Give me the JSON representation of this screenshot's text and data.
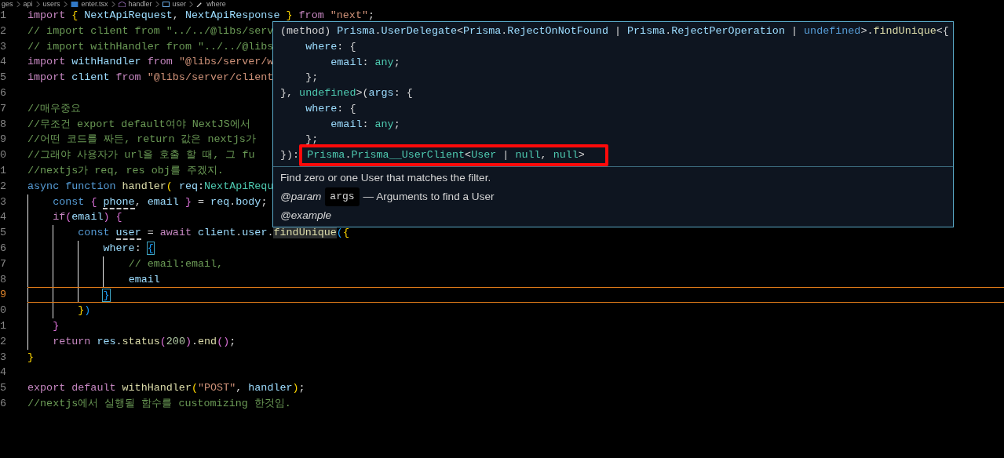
{
  "breadcrumb": [
    {
      "kind": "folder",
      "label": "ges"
    },
    {
      "kind": "folder",
      "label": "api"
    },
    {
      "kind": "folder",
      "label": "users"
    },
    {
      "kind": "file",
      "label": "enter.tsx"
    },
    {
      "kind": "function",
      "label": "handler"
    },
    {
      "kind": "variable",
      "label": "user"
    },
    {
      "kind": "property",
      "label": "where"
    }
  ],
  "editor": {
    "lines": [
      {
        "number": "1",
        "active": false,
        "tokens": [
          {
            "kind": "kw",
            "text": "import "
          },
          {
            "kind": "b1",
            "text": "{ "
          },
          {
            "kind": "var",
            "text": "NextApiRequest"
          },
          {
            "kind": "p",
            "text": ", "
          },
          {
            "kind": "var",
            "text": "NextApiResponse "
          },
          {
            "kind": "b1",
            "text": "} "
          },
          {
            "kind": "kw",
            "text": "from "
          },
          {
            "kind": "str",
            "text": "\"next\""
          },
          {
            "kind": "p",
            "text": ";"
          }
        ]
      },
      {
        "number": "2",
        "active": false,
        "tokens": [
          {
            "kind": "com",
            "text": "// import client from \"../../@libs/serv"
          }
        ]
      },
      {
        "number": "3",
        "active": false,
        "tokens": [
          {
            "kind": "com",
            "text": "// import withHandler from \"../../@libs"
          }
        ]
      },
      {
        "number": "4",
        "active": false,
        "tokens": [
          {
            "kind": "kw",
            "text": "import "
          },
          {
            "kind": "var",
            "text": "withHandler "
          },
          {
            "kind": "kw",
            "text": "from "
          },
          {
            "kind": "str",
            "text": "\"@libs/server/w"
          }
        ]
      },
      {
        "number": "5",
        "active": false,
        "tokens": [
          {
            "kind": "kw",
            "text": "import "
          },
          {
            "kind": "var",
            "text": "client "
          },
          {
            "kind": "kw",
            "text": "from "
          },
          {
            "kind": "str",
            "text": "\"@libs/server/client"
          }
        ]
      },
      {
        "number": "6",
        "active": false
      },
      {
        "number": "7",
        "active": false,
        "tokens": [
          {
            "kind": "com",
            "text": "//매우중요"
          }
        ]
      },
      {
        "number": "8",
        "active": false,
        "tokens": [
          {
            "kind": "com",
            "text": "//무조건 export default여야 NextJS에서"
          }
        ]
      },
      {
        "number": "9",
        "active": false,
        "tokens": [
          {
            "kind": "com",
            "text": "//어떤 코드를 짜든, return 값은 nextjs가"
          }
        ]
      },
      {
        "number": "0",
        "active": false,
        "tokens": [
          {
            "kind": "com",
            "text": "//그래야 사용자가 url을 호출 할 때, 그 fu"
          }
        ]
      },
      {
        "number": "1",
        "active": false,
        "tokens": [
          {
            "kind": "com",
            "text": "//nextjs가 req, res obj를 주겠지."
          }
        ]
      },
      {
        "number": "2",
        "active": false,
        "tokens": [
          {
            "kind": "st",
            "text": "async "
          },
          {
            "kind": "st",
            "text": "function "
          },
          {
            "kind": "fn",
            "text": "handler"
          },
          {
            "kind": "b1",
            "text": "( "
          },
          {
            "kind": "var",
            "text": "req"
          },
          {
            "kind": "p",
            "text": ":"
          },
          {
            "kind": "type",
            "text": "NextApiRequ"
          }
        ]
      },
      {
        "number": "3",
        "active": false,
        "tokens": [
          {
            "kind": "st",
            "text": "    const "
          },
          {
            "kind": "b2",
            "text": "{ "
          },
          {
            "kind": "unused",
            "text": "phone"
          },
          {
            "kind": "p",
            "text": ", "
          },
          {
            "kind": "var",
            "text": "email "
          },
          {
            "kind": "b2",
            "text": "}"
          },
          {
            "kind": "p",
            "text": " = "
          },
          {
            "kind": "var",
            "text": "req"
          },
          {
            "kind": "p",
            "text": "."
          },
          {
            "kind": "var",
            "text": "body"
          },
          {
            "kind": "p",
            "text": ";"
          }
        ]
      },
      {
        "number": "4",
        "active": false,
        "tokens": [
          {
            "kind": "kw",
            "text": "    if"
          },
          {
            "kind": "b2",
            "text": "("
          },
          {
            "kind": "var",
            "text": "email"
          },
          {
            "kind": "b2",
            "text": ") {"
          }
        ]
      },
      {
        "number": "5",
        "active": false,
        "tokens": [
          {
            "kind": "st",
            "text": "        const "
          },
          {
            "kind": "unused",
            "text": "user"
          },
          {
            "kind": "p",
            "text": " = "
          },
          {
            "kind": "kw",
            "text": "await "
          },
          {
            "kind": "var",
            "text": "client"
          },
          {
            "kind": "p",
            "text": "."
          },
          {
            "kind": "var",
            "text": "user"
          },
          {
            "kind": "p",
            "text": "."
          },
          {
            "kind": "fnhl",
            "text": "findUnique"
          },
          {
            "kind": "b3",
            "text": "("
          },
          {
            "kind": "b1",
            "text": "{"
          }
        ]
      },
      {
        "number": "6",
        "active": false,
        "tokens": [
          {
            "kind": "var",
            "text": "            where"
          },
          {
            "kind": "p",
            "text": ": "
          },
          {
            "kind": "match",
            "text": "{"
          }
        ]
      },
      {
        "number": "7",
        "active": false,
        "tokens": [
          {
            "kind": "com",
            "text": "                // email:email,"
          }
        ]
      },
      {
        "number": "8",
        "active": false,
        "tokens": [
          {
            "kind": "var",
            "text": "                email"
          }
        ]
      },
      {
        "number": "9",
        "active": true,
        "tokens": [
          {
            "kind": "match",
            "text": "            }"
          }
        ]
      },
      {
        "number": "0",
        "active": false,
        "tokens": [
          {
            "kind": "b1",
            "text": "        }"
          },
          {
            "kind": "b3",
            "text": ")"
          }
        ]
      },
      {
        "number": "1",
        "active": false,
        "tokens": [
          {
            "kind": "b2",
            "text": "    }"
          }
        ]
      },
      {
        "number": "2",
        "active": false,
        "tokens": [
          {
            "kind": "kw",
            "text": "    return "
          },
          {
            "kind": "var",
            "text": "res"
          },
          {
            "kind": "p",
            "text": "."
          },
          {
            "kind": "fn",
            "text": "status"
          },
          {
            "kind": "b2",
            "text": "("
          },
          {
            "kind": "num",
            "text": "200"
          },
          {
            "kind": "b2",
            "text": ")"
          },
          {
            "kind": "p",
            "text": "."
          },
          {
            "kind": "fn",
            "text": "end"
          },
          {
            "kind": "b2",
            "text": "()"
          },
          {
            "kind": "p",
            "text": ";"
          }
        ]
      },
      {
        "number": "3",
        "active": false,
        "tokens": [
          {
            "kind": "b1",
            "text": "}"
          }
        ]
      },
      {
        "number": "4",
        "active": false
      },
      {
        "number": "5",
        "active": false,
        "tokens": [
          {
            "kind": "kw",
            "text": "export "
          },
          {
            "kind": "kw",
            "text": "default "
          },
          {
            "kind": "fn",
            "text": "withHandler"
          },
          {
            "kind": "b1",
            "text": "("
          },
          {
            "kind": "str",
            "text": "\"POST\""
          },
          {
            "kind": "p",
            "text": ", "
          },
          {
            "kind": "var",
            "text": "handler"
          },
          {
            "kind": "b1",
            "text": ")"
          },
          {
            "kind": "p",
            "text": ";"
          }
        ]
      },
      {
        "number": "6",
        "active": false,
        "tokens": [
          {
            "kind": "com",
            "text": "//nextjs에서 실행될 함수를 customizing 한것임."
          }
        ]
      }
    ]
  },
  "hover_popup": {
    "signature_lines": [
      {
        "boxed": false,
        "tokens": [
          {
            "kind": "p",
            "text": "(method) "
          },
          {
            "kind": "var",
            "text": "Prisma"
          },
          {
            "kind": "p",
            "text": "."
          },
          {
            "kind": "var",
            "text": "UserDelegate"
          },
          {
            "kind": "p",
            "text": "<"
          },
          {
            "kind": "var",
            "text": "Prisma"
          },
          {
            "kind": "p",
            "text": "."
          },
          {
            "kind": "var",
            "text": "RejectOnNotFound"
          },
          {
            "kind": "p",
            "text": " | "
          },
          {
            "kind": "var",
            "text": "Prisma"
          },
          {
            "kind": "p",
            "text": "."
          },
          {
            "kind": "var",
            "text": "RejectPerOperation"
          },
          {
            "kind": "p",
            "text": " | "
          },
          {
            "kind": "st",
            "text": "undefined"
          },
          {
            "kind": "p",
            "text": ">."
          },
          {
            "kind": "fn",
            "text": "findUnique"
          },
          {
            "kind": "p",
            "text": "<{"
          }
        ]
      },
      {
        "boxed": false,
        "tokens": [
          {
            "kind": "var",
            "text": "    where"
          },
          {
            "kind": "p",
            "text": ": {"
          }
        ]
      },
      {
        "boxed": false,
        "tokens": [
          {
            "kind": "var",
            "text": "        email"
          },
          {
            "kind": "p",
            "text": ": "
          },
          {
            "kind": "type",
            "text": "any"
          },
          {
            "kind": "p",
            "text": ";"
          }
        ]
      },
      {
        "boxed": false,
        "tokens": [
          {
            "kind": "p",
            "text": "    };"
          }
        ]
      },
      {
        "boxed": false,
        "tokens": [
          {
            "kind": "p",
            "text": "}, "
          },
          {
            "kind": "type",
            "text": "undefined"
          },
          {
            "kind": "p",
            "text": ">("
          },
          {
            "kind": "var",
            "text": "args"
          },
          {
            "kind": "p",
            "text": ": {"
          }
        ]
      },
      {
        "boxed": false,
        "tokens": [
          {
            "kind": "var",
            "text": "    where"
          },
          {
            "kind": "p",
            "text": ": {"
          }
        ]
      },
      {
        "boxed": false,
        "tokens": [
          {
            "kind": "var",
            "text": "        email"
          },
          {
            "kind": "p",
            "text": ": "
          },
          {
            "kind": "type",
            "text": "any"
          },
          {
            "kind": "p",
            "text": ";"
          }
        ]
      },
      {
        "boxed": false,
        "tokens": [
          {
            "kind": "p",
            "text": "    };"
          }
        ]
      },
      {
        "boxed": true,
        "lead": "}): ",
        "tokens": [
          {
            "kind": "type",
            "text": "Prisma"
          },
          {
            "kind": "p",
            "text": "."
          },
          {
            "kind": "type",
            "text": "Prisma__UserClient"
          },
          {
            "kind": "p",
            "text": "<"
          },
          {
            "kind": "type",
            "text": "User"
          },
          {
            "kind": "p",
            "text": " | "
          },
          {
            "kind": "type",
            "text": "null"
          },
          {
            "kind": "p",
            "text": ", "
          },
          {
            "kind": "type",
            "text": "null"
          },
          {
            "kind": "p",
            "text": ">"
          }
        ]
      }
    ],
    "description": "Find zero or one User that matches the filter.",
    "param": {
      "tag": "@param",
      "name": "args",
      "text": "— Arguments to find a User"
    },
    "example_tag": "@example"
  }
}
